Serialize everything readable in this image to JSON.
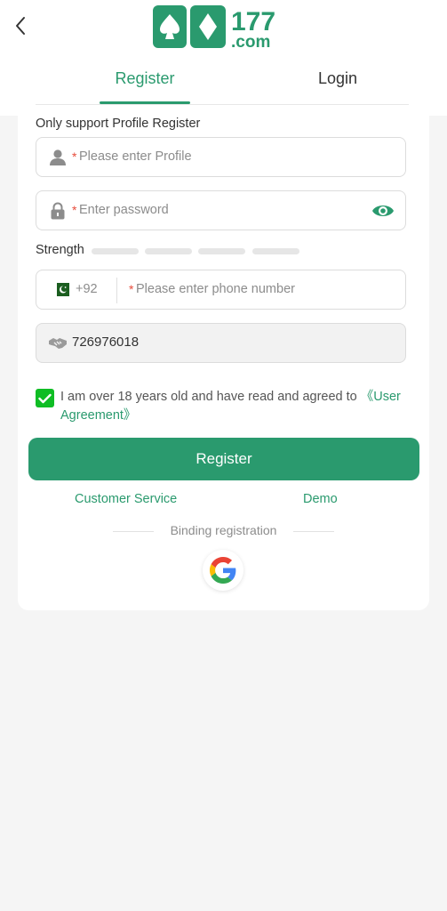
{
  "header": {
    "back_icon": "chevron-left-icon",
    "logo_text": "RS177.com"
  },
  "tabs": [
    {
      "label": "Register",
      "active": true
    },
    {
      "label": "Login",
      "active": false
    }
  ],
  "form": {
    "notice": "Only support Profile Register",
    "required_mark": "*",
    "profile": {
      "icon": "user-icon",
      "placeholder": "Please enter Profile"
    },
    "password": {
      "icon": "lock-icon",
      "placeholder": "Enter password",
      "toggle_icon": "eye-icon"
    },
    "strength_label": "Strength",
    "phone": {
      "flag_icon": "pakistan-flag-icon",
      "country_code": "+92",
      "placeholder": "Please enter phone number"
    },
    "invite": {
      "icon": "handshake-icon",
      "value": "726976018"
    },
    "agreement": {
      "checked": true,
      "text": "I am over 18 years old and have read and agreed to ",
      "link": "《User Agreement》"
    },
    "submit_label": "Register"
  },
  "links": {
    "customer_service": "Customer Service",
    "demo": "Demo"
  },
  "binding": {
    "label": "Binding registration",
    "google_icon": "google-icon"
  },
  "colors": {
    "primary": "#2a9a6e",
    "checkbox": "#0fbd24",
    "required": "#e74c3c",
    "background": "#f5f5f5"
  }
}
